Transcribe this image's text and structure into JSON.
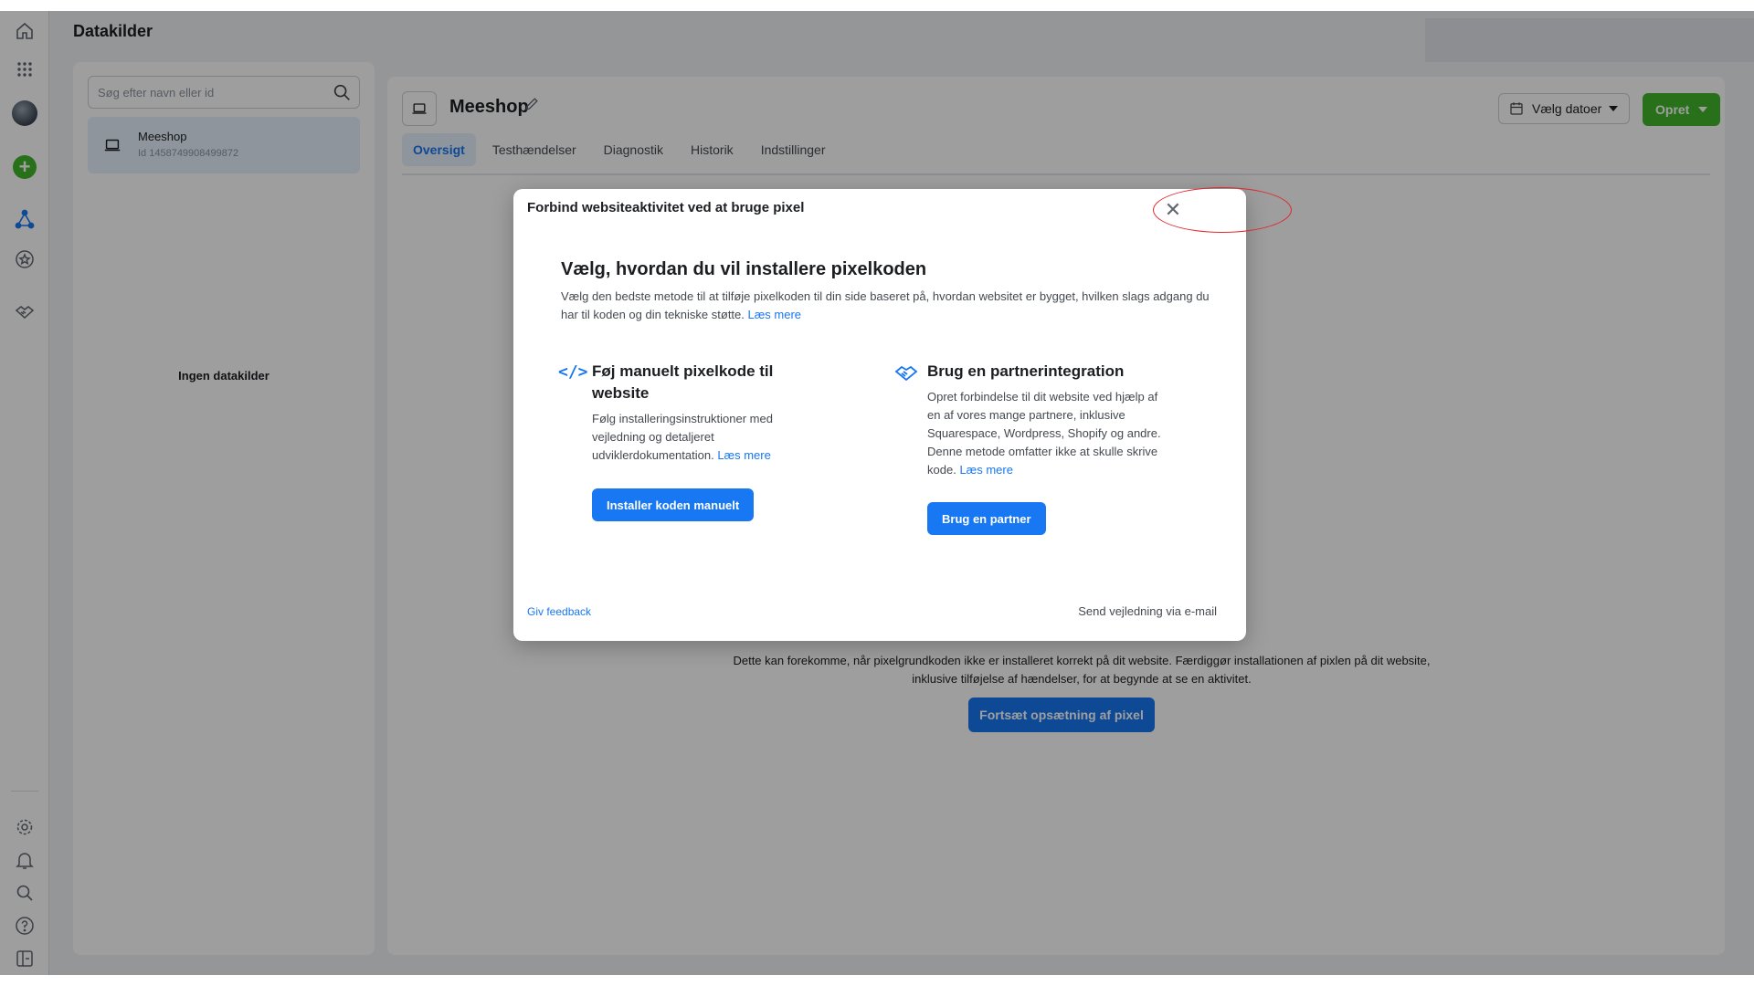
{
  "app": {
    "page_title": "Datakilder"
  },
  "left_panel": {
    "search_placeholder": "Søg efter navn eller id",
    "source": {
      "name": "Meeshop",
      "id_text": "Id 1458749908499872"
    },
    "empty_label": "Ingen datakilder"
  },
  "main": {
    "pixel_name": "Meeshop",
    "tabs": [
      {
        "label": "Oversigt",
        "active": true
      },
      {
        "label": "Testhændelser",
        "active": false
      },
      {
        "label": "Diagnostik",
        "active": false
      },
      {
        "label": "Historik",
        "active": false
      },
      {
        "label": "Indstillinger",
        "active": false
      }
    ],
    "date_button": "Vælg datoer",
    "create_button": "Opret",
    "empty_text": "Dette kan forekomme, når pixelgrundkoden ikke er installeret korrekt på dit website. Færdiggør installationen af pixlen på dit website, inklusive tilføjelse af hændelser, for at begynde at se en aktivitet.",
    "continue_button": "Fortsæt opsætning af pixel"
  },
  "modal": {
    "title": "Forbind websiteaktivitet ved at bruge pixel",
    "heading": "Vælg, hvordan du vil installere pixelkoden",
    "description": "Vælg den bedste metode til at tilføje pixelkoden til din side baseret på, hvordan websitet er bygget, hvilken slags adgang du har til koden og din tekniske støtte.",
    "learn_more": "Læs mere",
    "manual": {
      "icon_glyph": "</>",
      "title": "Føj manuelt pixelkode til website",
      "description": "Følg installeringsinstruktioner med vejledning og detaljeret udviklerdokumentation.",
      "learn_more": "Læs mere",
      "button": "Installer koden manuelt"
    },
    "partner": {
      "title": "Brug en partnerintegration",
      "description": "Opret forbindelse til dit website ved hjælp af en af vores mange partnere, inklusive Squarespace, Wordpress, Shopify og andre. Denne metode omfatter ikke at skulle skrive kode.",
      "learn_more": "Læs mere",
      "button": "Brug en partner"
    },
    "feedback_link": "Giv feedback",
    "email_link": "Send vejledning via e-mail"
  },
  "colors": {
    "accent": "#1877f2",
    "create": "#42b72a",
    "highlight": "#e0282e"
  }
}
